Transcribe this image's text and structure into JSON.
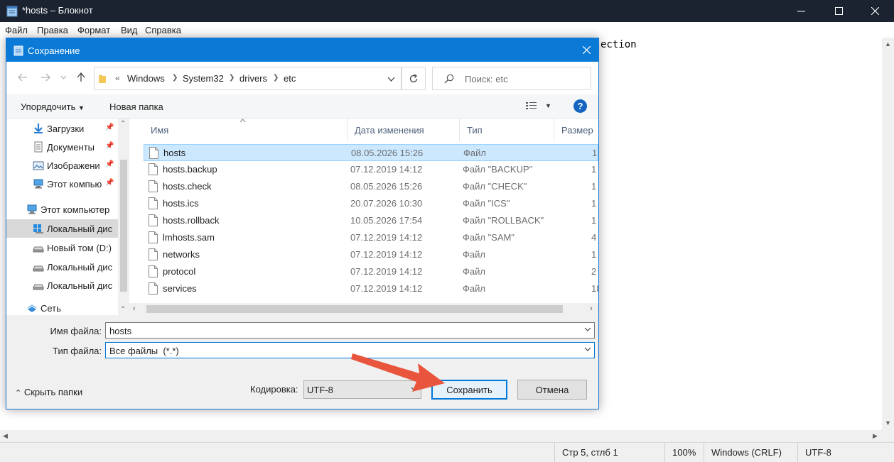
{
  "notepad": {
    "title": "*hosts – Блокнот",
    "menu": [
      "Файл",
      "Правка",
      "Формат",
      "Вид",
      "Справка"
    ],
    "editor_visible_text": "ection",
    "status": {
      "position": "Стр 5, стлб 1",
      "zoom": "100%",
      "line_ending": "Windows (CRLF)",
      "encoding": "UTF-8"
    }
  },
  "dialog": {
    "title": "Сохранение",
    "breadcrumb": [
      "«",
      "Windows",
      "System32",
      "drivers",
      "etc"
    ],
    "search_placeholder": "Поиск: etc",
    "toolbar": {
      "organize": "Упорядочить",
      "new_folder": "Новая папка"
    },
    "nav_items": [
      {
        "label": "Загрузки",
        "icon": "download-arrow-icon",
        "pinned": true
      },
      {
        "label": "Документы",
        "icon": "document-icon",
        "pinned": true
      },
      {
        "label": "Изображени",
        "icon": "picture-icon",
        "pinned": true
      },
      {
        "label": "Этот компью",
        "icon": "computer-icon",
        "pinned": true
      },
      {
        "label": "Этот компьютер",
        "icon": "computer-icon",
        "pinned": false
      },
      {
        "label": "Локальный дис",
        "icon": "windows-drive-icon",
        "pinned": false,
        "selected": true
      },
      {
        "label": "Новый том (D:)",
        "icon": "drive-icon",
        "pinned": false
      },
      {
        "label": "Локальный дис",
        "icon": "drive-icon",
        "pinned": false
      },
      {
        "label": "Локальный дис",
        "icon": "drive-icon",
        "pinned": false
      },
      {
        "label": "Сеть",
        "icon": "network-icon",
        "pinned": false
      }
    ],
    "columns": [
      "Имя",
      "Дата изменения",
      "Тип",
      "Размер"
    ],
    "files": [
      {
        "name": "hosts",
        "date": "08.05.2026 15:26",
        "type": "Файл",
        "size": "1",
        "selected": true
      },
      {
        "name": "hosts.backup",
        "date": "07.12.2019 14:12",
        "type": "Файл \"BACKUP\"",
        "size": "1"
      },
      {
        "name": "hosts.check",
        "date": "08.05.2026 15:26",
        "type": "Файл \"CHECK\"",
        "size": "1"
      },
      {
        "name": "hosts.ics",
        "date": "20.07.2026 10:30",
        "type": "Файл \"ICS\"",
        "size": "1"
      },
      {
        "name": "hosts.rollback",
        "date": "10.05.2026 17:54",
        "type": "Файл \"ROLLBACK\"",
        "size": "1"
      },
      {
        "name": "lmhosts.sam",
        "date": "07.12.2019 14:12",
        "type": "Файл \"SAM\"",
        "size": "4"
      },
      {
        "name": "networks",
        "date": "07.12.2019 14:12",
        "type": "Файл",
        "size": "1"
      },
      {
        "name": "protocol",
        "date": "07.12.2019 14:12",
        "type": "Файл",
        "size": "2"
      },
      {
        "name": "services",
        "date": "07.12.2019 14:12",
        "type": "Файл",
        "size": "18"
      }
    ],
    "filename_label": "Имя файла:",
    "filename_value": "hosts",
    "filetype_label": "Тип файла:",
    "filetype_value": "Все файлы  (*.*)",
    "hide_folders": "Скрыть папки",
    "encoding_label": "Кодировка:",
    "encoding_value": "UTF-8",
    "save_button": "Сохранить",
    "cancel_button": "Отмена"
  },
  "colors": {
    "titlebar_dark": "#1b2230",
    "dialog_title_blue": "#0a7ad6",
    "selection": "#cce8ff",
    "accent": "#0078d7",
    "annotation_arrow": "#e8553c"
  }
}
